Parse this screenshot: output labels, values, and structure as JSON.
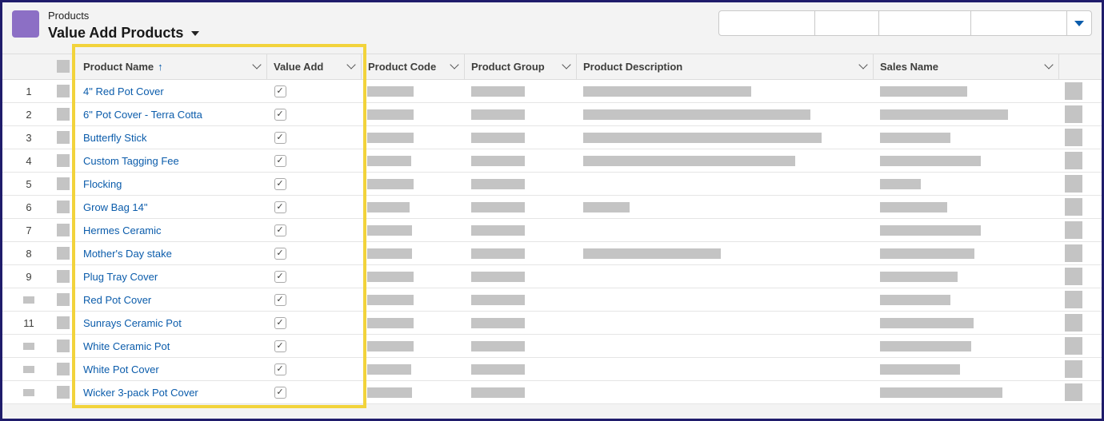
{
  "header": {
    "object_label": "Products",
    "list_title": "Value Add Products"
  },
  "columns": {
    "product_name": "Product Name",
    "sort_indicator": "↑",
    "value_add": "Value Add",
    "product_code": "Product Code",
    "product_group": "Product Group",
    "product_description": "Product Description",
    "sales_name": "Sales Name"
  },
  "rows": [
    {
      "num": "1",
      "name": "4\" Red Pot Cover",
      "value_add": true
    },
    {
      "num": "2",
      "name": "6\" Pot Cover - Terra Cotta",
      "value_add": true
    },
    {
      "num": "3",
      "name": "Butterfly Stick",
      "value_add": true
    },
    {
      "num": "4",
      "name": "Custom Tagging Fee",
      "value_add": true
    },
    {
      "num": "5",
      "name": "Flocking",
      "value_add": true
    },
    {
      "num": "6",
      "name": "Grow Bag 14\"",
      "value_add": true
    },
    {
      "num": "7",
      "name": "Hermes Ceramic",
      "value_add": true
    },
    {
      "num": "8",
      "name": "Mother's Day stake",
      "value_add": true
    },
    {
      "num": "9",
      "name": "Plug Tray Cover",
      "value_add": true
    },
    {
      "num": "",
      "name": "Red Pot Cover",
      "value_add": true
    },
    {
      "num": "11",
      "name": "Sunrays Ceramic Pot",
      "value_add": true
    },
    {
      "num": "",
      "name": "White Ceramic Pot",
      "value_add": true
    },
    {
      "num": "",
      "name": "White Pot Cover",
      "value_add": true
    },
    {
      "num": "",
      "name": "Wicker 3-pack Pot Cover",
      "value_add": true
    }
  ],
  "colors": {
    "link": "#0b5cab",
    "highlight": "#f2d33b",
    "object_icon": "#8c6fc5",
    "redacted": "#c4c4c4"
  },
  "icons": {
    "checkbox": "checkmark-icon",
    "list_switcher": "chevron-down-icon",
    "header_menu": "chevron-down-icon"
  }
}
